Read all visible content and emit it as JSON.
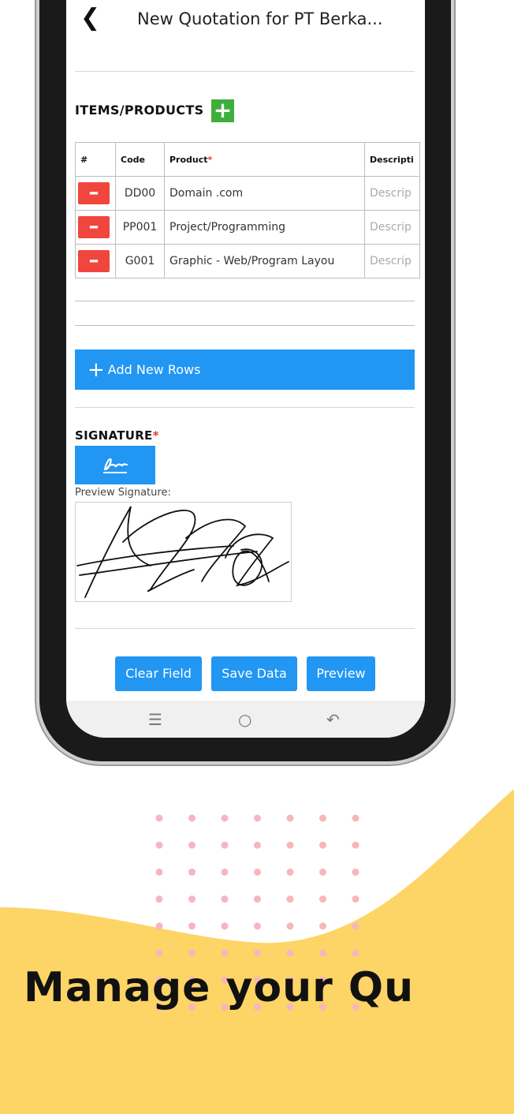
{
  "header": {
    "title": "New Quotation for PT Berka..."
  },
  "items_section": {
    "title": "ITEMS/PRODUCTS",
    "table": {
      "headers": [
        "#",
        "Code",
        "Product",
        "Descripti"
      ],
      "rows": [
        {
          "code": "DD00",
          "product": "Domain .com",
          "description_placeholder": "Descrip"
        },
        {
          "code": "PP001",
          "product": "Project/Programming",
          "description_placeholder": "Descrip"
        },
        {
          "code": "G001",
          "product": "Graphic - Web/Program Layou",
          "description_placeholder": "Descrip"
        }
      ]
    },
    "add_rows_label": "Add New Rows"
  },
  "signature_section": {
    "title": "SIGNATURE",
    "preview_label": "Preview Signature:"
  },
  "actions": {
    "clear_label": "Clear Field",
    "save_label": "Save Data",
    "preview_label": "Preview"
  },
  "marketing": {
    "headline": "Manage your Qu"
  },
  "colors": {
    "primary": "#2196f3",
    "add": "#3fae3d",
    "remove": "#f0463d",
    "wave": "#fdd466",
    "dots": "#f7b6bd"
  }
}
